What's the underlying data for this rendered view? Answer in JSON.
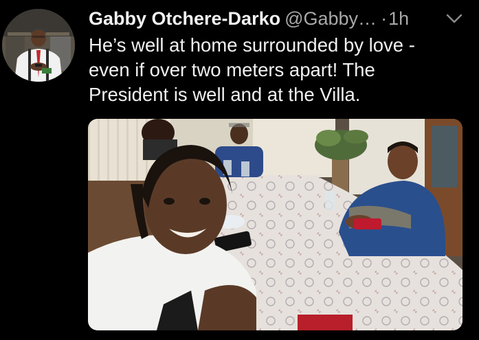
{
  "tweet": {
    "author": {
      "display_name": "Gabby Otchere-Darko",
      "handle": "@Gabby…",
      "avatar_icon": "avatar-photo"
    },
    "separator": "·",
    "time": "1h",
    "menu_icon": "chevron-down-icon",
    "text_lines": [
      "He’s well at home surrounded by love -",
      "even if over two meters apart! The",
      "President is well and at the Villa."
    ],
    "media": {
      "kind": "photo",
      "icon": "photo-family-at-table"
    }
  },
  "colors": {
    "background": "#000000",
    "primary_text": "#f0f0f0",
    "secondary_text": "#a9a9a9"
  }
}
